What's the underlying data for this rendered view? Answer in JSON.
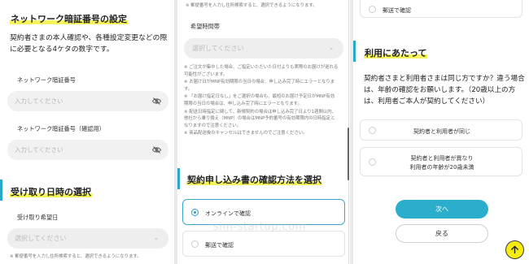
{
  "panel1": {
    "heading": "ネットワーク暗証番号の設定",
    "description": "契約者さまの本人確認や、各種設定変更などの際に必要となる4ケタの数字です。",
    "pin_label": "ネットワーク暗証番号",
    "pin_placeholder": "入力してください",
    "pin_confirm_label": "ネットワーク暗証番号（確認用）",
    "pin_confirm_placeholder": "入力してください",
    "receipt_heading": "受け取り日時の選択",
    "receipt_date_label": "受け取り希望日",
    "receipt_date_placeholder": "選択してください",
    "receipt_note": "※ 郵便番号を入力し住所検索すると、選択できるようになります。"
  },
  "panel2": {
    "top_note": "※ 郵便番号を入力し住所検索すると、選択できるようになります。",
    "time_label": "希望時間帯",
    "time_placeholder": "選択してください",
    "notes": [
      "※ ご注文が集中した場合、ご指定いただいた日付よりも実際のお届けが遅れる可能性がございます。",
      "※ お届け日がMNP有効期限の当日の場合、申し込み完了時にエラーとなります。",
      "※ 「お届け指定日なし」をご選択の場合も、最短のお届け予定日がMNP有効期限の当日の場合は、申し込み完了時にエラーとなります。",
      "※ 配送日時指定に関して、新規契約の場合は申し込み完了日より1週間以内、他社から乗り換え（MNP）の場合はMNP予約番号の有効期限内の日時指定となりますので注意ください。",
      "※ 商品配送後のキャンセルはできませんのでご注意ください。"
    ],
    "confirm_heading": "契約申し込み書の確認方法を選択",
    "options": [
      {
        "label": "オンラインで確認",
        "selected": true
      },
      {
        "label": "郵送で確認",
        "selected": false
      }
    ],
    "watermark": "sim-startup.com"
  },
  "panel3": {
    "top_option": "郵送で確認",
    "heading": "利用にあたって",
    "description": "契約者さまと利用者さまは同じ方ですか？違う場合は、年齢の確認をお願いします。（20歳以上の方は、利用者ご本人が契約してください）",
    "options": [
      {
        "label": "契約者と利用者が同じ",
        "selected": false
      },
      {
        "label": "契約者と利用者が異なり",
        "label2": "利用者の年齢が20歳未満",
        "selected": false
      }
    ],
    "next_button": "次へ",
    "back_button": "戻る"
  },
  "colors": {
    "accent": "#2aaecb",
    "highlight": "#f4f35a",
    "fab": "#f7ec12"
  },
  "icons": [
    "eye-slash-icon",
    "chevron-down-icon",
    "arrow-up-icon"
  ]
}
